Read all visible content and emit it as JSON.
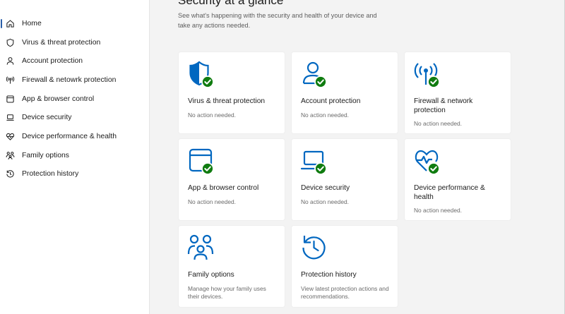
{
  "sidebar": {
    "items": [
      {
        "label": "Home",
        "icon": "home-icon",
        "active": true
      },
      {
        "label": "Virus & threat protection",
        "icon": "shield-icon"
      },
      {
        "label": "Account protection",
        "icon": "person-icon"
      },
      {
        "label": "Firewall & netowrk protection",
        "icon": "antenna-icon"
      },
      {
        "label": "App & browser control",
        "icon": "browser-window-icon"
      },
      {
        "label": "Device security",
        "icon": "laptop-icon"
      },
      {
        "label": "Device performance & health",
        "icon": "heart-pulse-icon"
      },
      {
        "label": "Family options",
        "icon": "family-icon"
      },
      {
        "label": "Protection history",
        "icon": "history-icon"
      }
    ]
  },
  "main": {
    "title": "Security at a glance",
    "subtitle": "See what's happening with the security and health of your device and take any actions needed."
  },
  "cards": [
    {
      "title": "Virus & threat protection",
      "status": "No action needed.",
      "icon": "shield-check-icon"
    },
    {
      "title": "Account protection",
      "status": "No action needed.",
      "icon": "person-check-icon"
    },
    {
      "title": "Firewall & network protection",
      "status": "No action needed.",
      "icon": "antenna-check-icon"
    },
    {
      "title": "App & browser control",
      "status": "No action needed.",
      "icon": "browser-check-icon"
    },
    {
      "title": "Device security",
      "status": "No action needed.",
      "icon": "laptop-check-icon"
    },
    {
      "title": "Device performance & health",
      "status": "No action needed.",
      "icon": "heart-check-icon"
    },
    {
      "title": "Family options",
      "status": "Manage how your family uses their devices.",
      "icon": "family-icon"
    },
    {
      "title": "Protection history",
      "status": "View latest protection actions and recommendations.",
      "icon": "history-icon"
    }
  ],
  "colors": {
    "accent": "#0067c0",
    "ok_badge": "#107c10",
    "nav_indicator": "#2a5ea8"
  }
}
